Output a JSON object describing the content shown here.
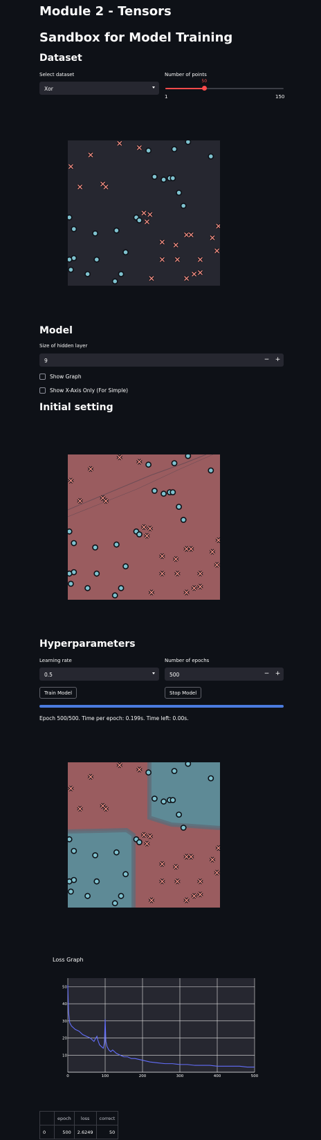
{
  "titles": {
    "module": "Module 2 - Tensors",
    "sandbox": "Sandbox for Model Training",
    "dataset": "Dataset",
    "model": "Model",
    "initial": "Initial setting",
    "hyper": "Hyperparameters"
  },
  "dataset": {
    "select_label": "Select dataset",
    "select_value": "Xor",
    "points_label": "Number of points",
    "points_value": "50",
    "points_min": "1",
    "points_max": "150",
    "points_fraction": 0.329
  },
  "model": {
    "hidden_label": "Size of hidden layer",
    "hidden_value": "9",
    "show_graph": "Show Graph",
    "show_xaxis": "Show X-Axis Only (For Simple)"
  },
  "hyper": {
    "lr_label": "Learning rate",
    "lr_value": "0.5",
    "epochs_label": "Number of epochs",
    "epochs_value": "500",
    "train_button": "Train Model",
    "stop_button": "Stop Model",
    "progress": 1.0,
    "status": "Epoch 500/500. Time per epoch: 0.199s. Time left: 0.00s."
  },
  "stepper": {
    "minus": "−",
    "plus": "+"
  },
  "points": {
    "o": [
      [
        0.53,
        0.07
      ],
      [
        0.7,
        0.06
      ],
      [
        0.79,
        0.01
      ],
      [
        0.94,
        0.11
      ],
      [
        0.57,
        0.25
      ],
      [
        0.63,
        0.27
      ],
      [
        0.67,
        0.26
      ],
      [
        0.69,
        0.26
      ],
      [
        0.73,
        0.36
      ],
      [
        0.76,
        0.45
      ],
      [
        0.45,
        0.53
      ],
      [
        0.47,
        0.55
      ],
      [
        0.01,
        0.53
      ],
      [
        0.04,
        0.61
      ],
      [
        0.18,
        0.64
      ],
      [
        0.32,
        0.62
      ],
      [
        0.38,
        0.77
      ],
      [
        0.19,
        0.82
      ],
      [
        0.04,
        0.81
      ],
      [
        0.01,
        0.82
      ],
      [
        0.02,
        0.89
      ],
      [
        0.13,
        0.92
      ],
      [
        0.35,
        0.92
      ],
      [
        0.31,
        0.97
      ]
    ],
    "x": [
      [
        0.34,
        0.02
      ],
      [
        0.15,
        0.1
      ],
      [
        0.47,
        0.05
      ],
      [
        0.02,
        0.18
      ],
      [
        0.08,
        0.32
      ],
      [
        0.23,
        0.3
      ],
      [
        0.25,
        0.32
      ],
      [
        0.5,
        0.5
      ],
      [
        0.54,
        0.51
      ],
      [
        0.52,
        0.56
      ],
      [
        0.62,
        0.7
      ],
      [
        0.71,
        0.72
      ],
      [
        0.78,
        0.65
      ],
      [
        0.81,
        0.65
      ],
      [
        0.95,
        0.67
      ],
      [
        0.99,
        0.59
      ],
      [
        0.98,
        0.76
      ],
      [
        0.62,
        0.82
      ],
      [
        0.72,
        0.82
      ],
      [
        0.87,
        0.82
      ],
      [
        0.78,
        0.95
      ],
      [
        0.83,
        0.92
      ],
      [
        0.87,
        0.91
      ],
      [
        0.55,
        0.95
      ]
    ]
  },
  "loss_graph": {
    "title": "Loss Graph"
  },
  "chart_data": {
    "type": "line",
    "title": "Loss Graph",
    "xlim": [
      0,
      500
    ],
    "ylim": [
      0,
      55
    ],
    "xticks": [
      0,
      100,
      200,
      300,
      400,
      500
    ],
    "yticks": [
      10,
      20,
      30,
      40,
      50
    ],
    "grid": true,
    "series": [
      {
        "color": "#636efa",
        "x": [
          0,
          2,
          5,
          10,
          20,
          30,
          40,
          50,
          60,
          65,
          70,
          75,
          78,
          80,
          85,
          90,
          95,
          98,
          100,
          102,
          105,
          110,
          115,
          120,
          130,
          140,
          150,
          160,
          170,
          180,
          190,
          200,
          220,
          240,
          260,
          280,
          300,
          320,
          340,
          360,
          380,
          400,
          420,
          440,
          460,
          480,
          500
        ],
        "y": [
          51,
          35,
          29,
          27,
          25,
          24,
          22,
          21,
          20,
          19,
          18,
          20,
          21,
          19,
          16,
          15,
          14,
          17,
          31,
          18,
          15,
          13,
          12,
          13,
          11,
          10,
          9,
          9,
          8,
          8,
          7.5,
          7,
          6,
          5.5,
          5,
          5,
          4.5,
          4.5,
          4,
          4,
          4,
          3.5,
          3.5,
          3.5,
          3.5,
          3,
          3
        ]
      }
    ]
  },
  "table": {
    "headers": [
      "",
      "epoch",
      "loss",
      "correct"
    ],
    "rows": [
      [
        "0",
        "500",
        "2.6249",
        "50"
      ]
    ]
  }
}
